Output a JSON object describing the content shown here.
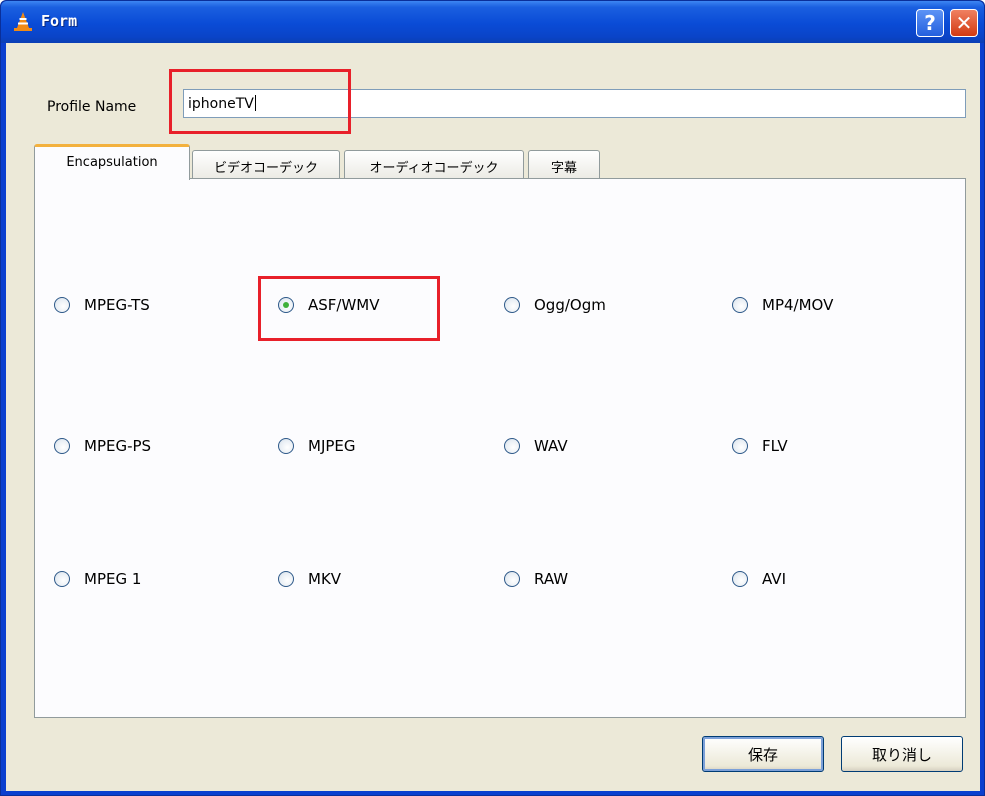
{
  "window": {
    "title": "Form",
    "help_label": "?",
    "close_label": "✕"
  },
  "profile": {
    "label": "Profile Name",
    "value": "iphoneTV"
  },
  "tabs": [
    {
      "label": "Encapsulation",
      "active": true
    },
    {
      "label": "ビデオコーデック",
      "active": false
    },
    {
      "label": "オーディオコーデック",
      "active": false
    },
    {
      "label": "字幕",
      "active": false
    }
  ],
  "encapsulation": {
    "selected": "ASF/WMV",
    "options": [
      {
        "label": "MPEG-TS",
        "checked": false
      },
      {
        "label": "ASF/WMV",
        "checked": true
      },
      {
        "label": "Ogg/Ogm",
        "checked": false
      },
      {
        "label": "MP4/MOV",
        "checked": false
      },
      {
        "label": "MPEG-PS",
        "checked": false
      },
      {
        "label": "MJPEG",
        "checked": false
      },
      {
        "label": "WAV",
        "checked": false
      },
      {
        "label": "FLV",
        "checked": false
      },
      {
        "label": "MPEG 1",
        "checked": false
      },
      {
        "label": "MKV",
        "checked": false
      },
      {
        "label": "RAW",
        "checked": false
      },
      {
        "label": "AVI",
        "checked": false
      }
    ]
  },
  "buttons": {
    "save": "保存",
    "cancel": "取り消し"
  },
  "colors": {
    "titlebar": "#0a4bd6",
    "dialog_bg": "#ece9d8",
    "highlight": "#e8202a",
    "radio_selected": "#3fb03a",
    "active_tab_accent": "#f3b13e"
  }
}
